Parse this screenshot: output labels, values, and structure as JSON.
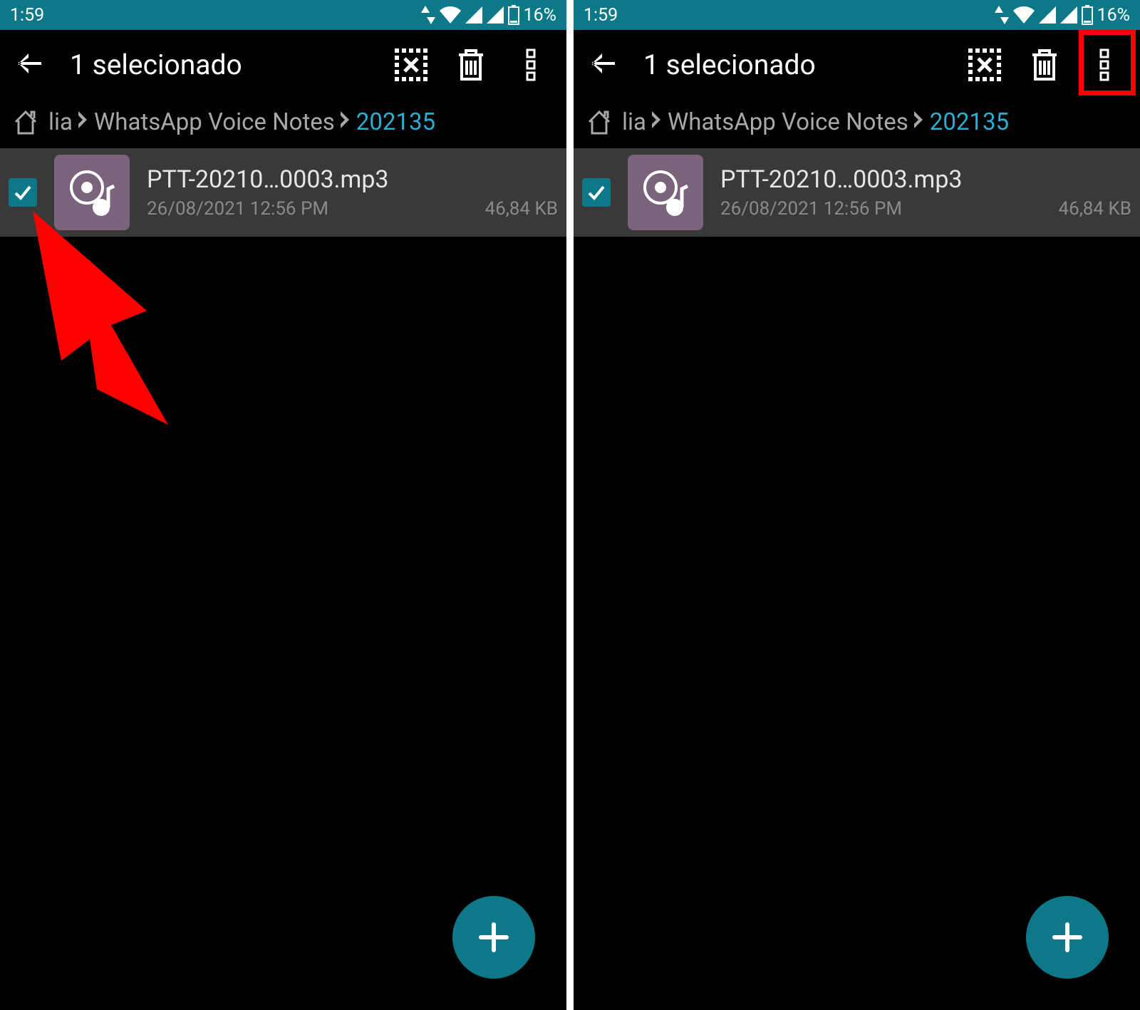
{
  "status": {
    "time": "1:59",
    "battery_pct": "16%"
  },
  "toolbar": {
    "title": "1 selecionado"
  },
  "breadcrumb": {
    "partial": "lia",
    "folder": "WhatsApp Voice Notes",
    "current": "202135"
  },
  "file": {
    "name": "PTT-20210…0003.mp3",
    "date": "26/08/2021 12:56 PM",
    "size": "46,84 KB"
  }
}
